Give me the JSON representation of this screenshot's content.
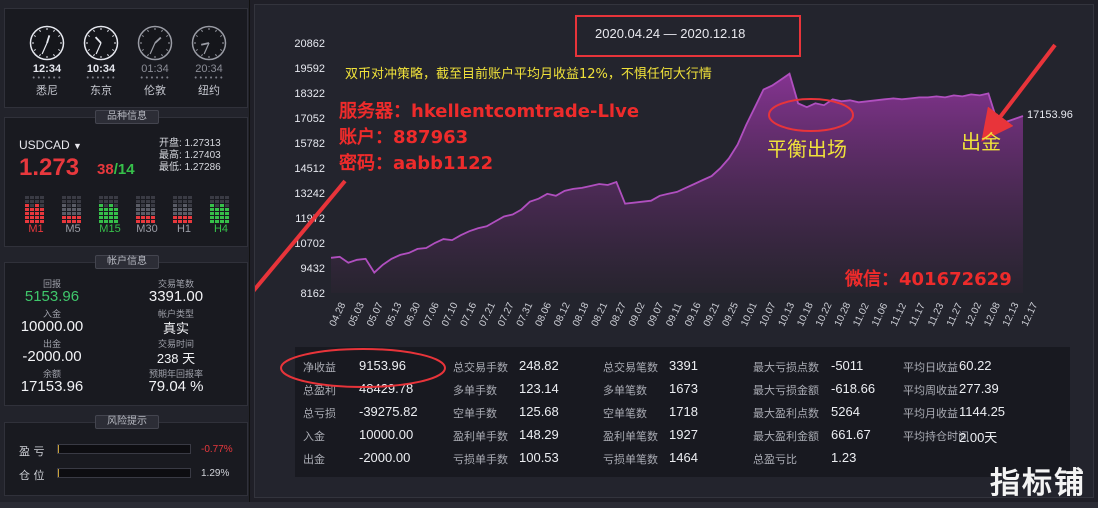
{
  "clocks": [
    {
      "time": "12:34",
      "city": "悉尼",
      "dim": false
    },
    {
      "time": "10:34",
      "city": "东京",
      "dim": false
    },
    {
      "time": "01:34",
      "city": "伦敦",
      "dim": true
    },
    {
      "time": "20:34",
      "city": "纽约",
      "dim": true
    }
  ],
  "quote": {
    "section_title": "品种信息",
    "symbol": "USDCAD",
    "price": "1.273",
    "pips_a": "38",
    "slash": "/",
    "pips_b": "14",
    "open": "开盘: 1.27313",
    "high": "最高: 1.27403",
    "low": "最低: 1.27286",
    "timeframes": [
      {
        "label": "M1",
        "color": "#e8383d"
      },
      {
        "label": "M5",
        "color": "#9a9ca5"
      },
      {
        "label": "M15",
        "color": "#36c04a"
      },
      {
        "label": "M30",
        "color": "#9a9ca5"
      },
      {
        "label": "H1",
        "color": "#9a9ca5"
      },
      {
        "label": "H4",
        "color": "#36c04a"
      }
    ]
  },
  "account": {
    "section_title": "帐户信息",
    "return_label": "回报",
    "return_value": "5153.96",
    "trades_label": "交易笔数",
    "trades_value": "3391.00",
    "deposit_label": "入金",
    "deposit_value": "10000.00",
    "type_label": "帐户类型",
    "type_value": "真实",
    "withdraw_label": "出金",
    "withdraw_value": "-2000.00",
    "time_label": "交易时间",
    "time_value": "238 天",
    "balance_label": "余额",
    "balance_value": "17153.96",
    "annual_label": "预期年回报率",
    "annual_value": "79.04 %"
  },
  "risk": {
    "section_title": "风险提示",
    "pnl_label": "盈 亏",
    "pnl_value": "-0.77%",
    "pnl_fill": 0.01,
    "pos_label": "仓 位",
    "pos_value": "1.29%",
    "pos_fill": 0.01
  },
  "chart_data": {
    "type": "area",
    "title": "",
    "xlabel": "",
    "ylabel": "",
    "ylim": [
      8162,
      20862
    ],
    "yticks": [
      "20862",
      "19592",
      "18322",
      "17052",
      "15782",
      "14512",
      "13242",
      "11972",
      "10702",
      "9432",
      "8162"
    ],
    "xticks": [
      "04.28",
      "05.03",
      "05.07",
      "05.13",
      "06.30",
      "07.06",
      "07.10",
      "07.16",
      "07.21",
      "07.27",
      "07.31",
      "08.06",
      "08.12",
      "08.18",
      "08.21",
      "08.27",
      "09.02",
      "09.07",
      "09.11",
      "09.16",
      "09.21",
      "09.25",
      "10.01",
      "10.07",
      "10.13",
      "10.18",
      "10.22",
      "10.28",
      "11.02",
      "11.06",
      "11.12",
      "11.17",
      "11.23",
      "11.27",
      "12.02",
      "12.08",
      "12.13",
      "12.17"
    ],
    "series": [
      {
        "values": [
          9950,
          10000,
          9700,
          9850,
          9900,
          9200,
          9600,
          9900,
          10100,
          10200,
          10400,
          10450,
          10700,
          10900,
          10850,
          11100,
          11300,
          11450,
          11550,
          11800,
          12050,
          12150,
          12400,
          12800,
          12950,
          13200,
          13100,
          13350,
          13450,
          13500,
          13600,
          13700,
          13650,
          13800,
          12700,
          12750,
          12800,
          12850,
          13100,
          13200,
          13300,
          13500,
          13700,
          13900,
          14100,
          14500,
          15000,
          15700,
          16700,
          17600,
          18500,
          18700,
          19000,
          19300,
          17800,
          17600,
          17800,
          17700,
          18000,
          17900,
          17950,
          17850,
          17900,
          17950,
          18000,
          18050,
          18000,
          18050,
          18100,
          18100,
          18150,
          18100,
          18200,
          18150,
          18250,
          18200,
          18300,
          16900,
          16850,
          17000,
          17153.96
        ]
      }
    ],
    "last_value_label": "17153.96",
    "grid": false,
    "color": "#b04fbf"
  },
  "annotations": {
    "date_range": "2020.04.24 — 2020.12.18",
    "strategy": "双币对冲策略，截至目前账户平均月收益12%，不惧任何大行情",
    "server": "服务器：hkellentcomtrade-Llve",
    "account": "账户：887963",
    "password": "密码：aabb1122",
    "wechat": "微信：401672629",
    "balanced_exit": "平衡出场",
    "withdrawal": "出金"
  },
  "stats": {
    "col1": [
      {
        "label": "净收益",
        "value": "9153.96"
      },
      {
        "label": "总盈利",
        "value": "48429.78"
      },
      {
        "label": "总亏损",
        "value": "-39275.82"
      },
      {
        "label": "入金",
        "value": "10000.00"
      },
      {
        "label": "出金",
        "value": "-2000.00"
      }
    ],
    "col2": [
      {
        "label": "总交易手数",
        "value": "248.82"
      },
      {
        "label": "多单手数",
        "value": "123.14"
      },
      {
        "label": "空单手数",
        "value": "125.68"
      },
      {
        "label": "盈利单手数",
        "value": "148.29"
      },
      {
        "label": "亏损单手数",
        "value": "100.53"
      }
    ],
    "col3": [
      {
        "label": "总交易笔数",
        "value": "3391"
      },
      {
        "label": "多单笔数",
        "value": "1673"
      },
      {
        "label": "空单笔数",
        "value": "1718"
      },
      {
        "label": "盈利单笔数",
        "value": "1927"
      },
      {
        "label": "亏损单笔数",
        "value": "1464"
      }
    ],
    "col4": [
      {
        "label": "最大亏损点数",
        "value": "-5011"
      },
      {
        "label": "最大亏损金额",
        "value": "-618.66"
      },
      {
        "label": "最大盈利点数",
        "value": "5264"
      },
      {
        "label": "最大盈利金额",
        "value": "661.67"
      },
      {
        "label": "总盈亏比",
        "value": "1.23"
      }
    ],
    "col5": [
      {
        "label": "平均日收益",
        "value": "60.22"
      },
      {
        "label": "平均周收益",
        "value": "277.39"
      },
      {
        "label": "平均月收益",
        "value": "1144.25"
      },
      {
        "label": "平均持仓时间",
        "value": "2.00天"
      }
    ]
  },
  "watermark": "指标铺"
}
